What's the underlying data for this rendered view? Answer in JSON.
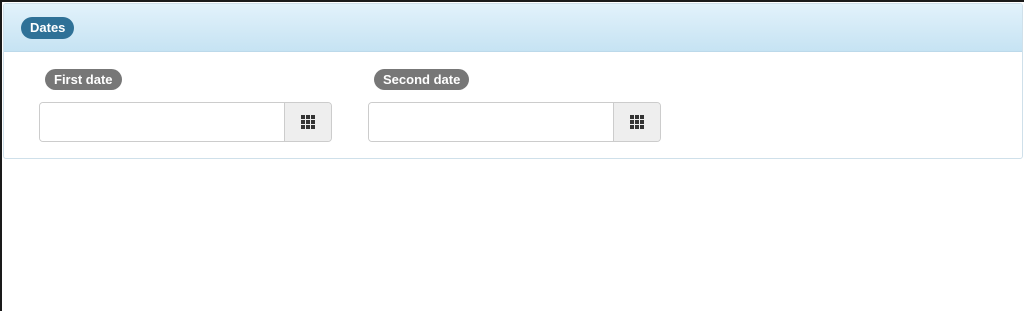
{
  "panel": {
    "title": "Dates"
  },
  "fields": [
    {
      "label": "First date",
      "value": "",
      "placeholder": "",
      "button_icon": "calendar-grid-icon"
    },
    {
      "label": "Second date",
      "value": "",
      "placeholder": "",
      "button_icon": "calendar-grid-icon"
    }
  ],
  "colors": {
    "header_gradient_top": "#e2f2fb",
    "header_gradient_bottom": "#c6e3f3",
    "header_badge": "#2f7197",
    "field_label_badge": "#777777",
    "button_background": "#eeeeee"
  }
}
